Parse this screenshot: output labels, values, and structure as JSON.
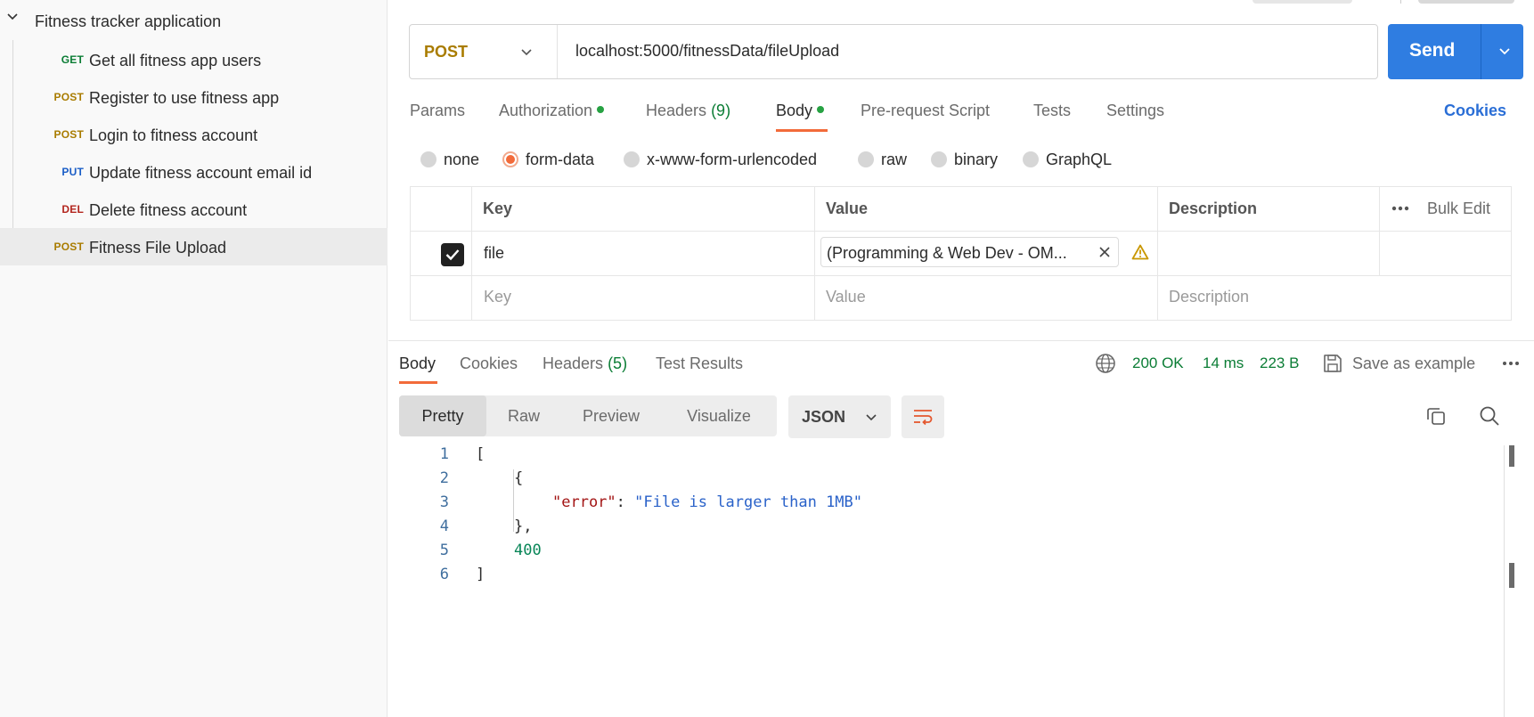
{
  "sidebar": {
    "collection_title": "Fitness tracker application",
    "requests": [
      {
        "method": "GET",
        "name": "Get all fitness app users"
      },
      {
        "method": "POST",
        "name": "Register to use fitness app"
      },
      {
        "method": "POST",
        "name": "Login to fitness account"
      },
      {
        "method": "PUT",
        "name": "Update fitness account email id"
      },
      {
        "method": "DEL",
        "name": "Delete fitness account"
      },
      {
        "method": "POST",
        "name": "Fitness File Upload"
      }
    ]
  },
  "request": {
    "method": "POST",
    "url": "localhost:5000/fitnessData/fileUpload",
    "send_label": "Send",
    "tabs": [
      {
        "label": "Params"
      },
      {
        "label": "Authorization"
      },
      {
        "label": "Headers",
        "count": "(9)"
      },
      {
        "label": "Body"
      },
      {
        "label": "Pre-request Script"
      },
      {
        "label": "Tests"
      },
      {
        "label": "Settings"
      }
    ],
    "cookies_label": "Cookies",
    "body_types": [
      "none",
      "form-data",
      "x-www-form-urlencoded",
      "raw",
      "binary",
      "GraphQL"
    ],
    "selected_body_type": "form-data",
    "form_table": {
      "headers": {
        "key": "Key",
        "value": "Value",
        "description": "Description",
        "bulk_edit": "Bulk Edit"
      },
      "rows": [
        {
          "checked": true,
          "key": "file",
          "value": "(Programming & Web Dev - OM...",
          "description": ""
        }
      ],
      "placeholder": {
        "key": "Key",
        "value": "Value",
        "description": "Description"
      }
    }
  },
  "response": {
    "tabs": [
      {
        "label": "Body"
      },
      {
        "label": "Cookies"
      },
      {
        "label": "Headers",
        "count": "(5)"
      },
      {
        "label": "Test Results"
      }
    ],
    "status": "200 OK",
    "time": "14 ms",
    "size": "223 B",
    "save_as_example": "Save as example",
    "formats": [
      "Pretty",
      "Raw",
      "Preview",
      "Visualize"
    ],
    "language": "JSON",
    "code_lines": [
      {
        "n": "1",
        "text": "["
      },
      {
        "n": "2",
        "text": "{"
      },
      {
        "n": "3",
        "key": "\"error\"",
        "sep": ": ",
        "value": "\"File is larger than 1MB\""
      },
      {
        "n": "4",
        "text": "},"
      },
      {
        "n": "5",
        "num": "400"
      },
      {
        "n": "6",
        "text": "]"
      }
    ]
  },
  "colors": {
    "accent": "#f26b3a",
    "send_button": "#2f7de1",
    "status_green": "#0b7d35",
    "post": "#a97c00",
    "get": "#0b7d35",
    "put": "#1b5ec7",
    "delete": "#b3261e"
  }
}
